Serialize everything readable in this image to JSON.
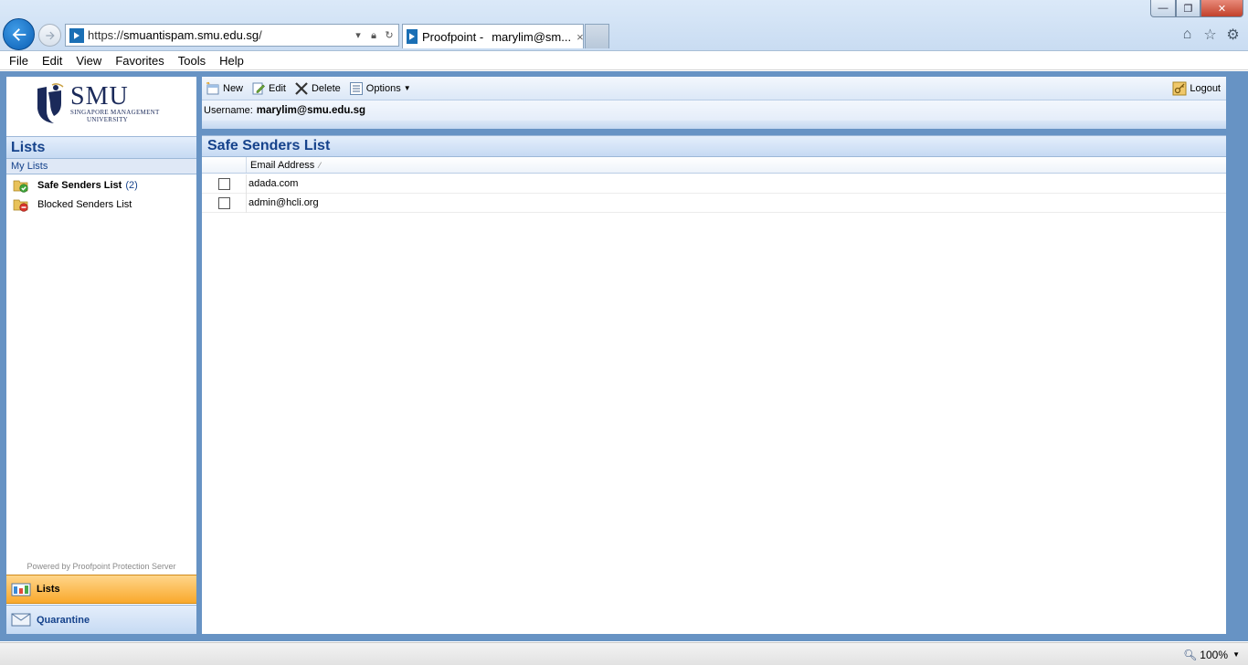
{
  "browser": {
    "url_prefix": "https://",
    "url_host": "smuantispam.smu.edu.sg",
    "url_suffix": "/",
    "tab_title_a": "Proofpoint - ",
    "tab_title_b": "marylim@sm...",
    "tab_close": "×",
    "win_min": "—",
    "win_max": "❐",
    "win_close": "✕",
    "zoom": "100%"
  },
  "menu": {
    "items": [
      "File",
      "Edit",
      "View",
      "Favorites",
      "Tools",
      "Help"
    ]
  },
  "logo": {
    "main": "SMU",
    "sub1": "SINGAPORE MANAGEMENT",
    "sub2": "UNIVERSITY"
  },
  "sidebar": {
    "header": "Lists",
    "section": "My Lists",
    "items": [
      {
        "label": "Safe Senders List",
        "count": "(2)",
        "icon": "safe-list-icon"
      },
      {
        "label": "Blocked Senders List",
        "count": "",
        "icon": "blocked-list-icon"
      }
    ],
    "powered_by": "Powered by Proofpoint Protection Server",
    "tabs": [
      {
        "label": "Lists",
        "icon": "lists-icon"
      },
      {
        "label": "Quarantine",
        "icon": "quarantine-icon"
      }
    ]
  },
  "toolbar": {
    "new_label": "New",
    "edit_label": "Edit",
    "delete_label": "Delete",
    "options_label": "Options",
    "logout_label": "Logout",
    "username_label": "Username:",
    "username_value": "marylim@smu.edu.sg"
  },
  "main": {
    "title": "Safe Senders List",
    "column_email": "Email Address",
    "rows": [
      {
        "email": "adada.com",
        "checked": false
      },
      {
        "email": "admin@hcli.org",
        "checked": false
      }
    ]
  },
  "colors": {
    "frame": "#6793c4",
    "header_text": "#15428b",
    "active_tab": "#f9a92c"
  }
}
